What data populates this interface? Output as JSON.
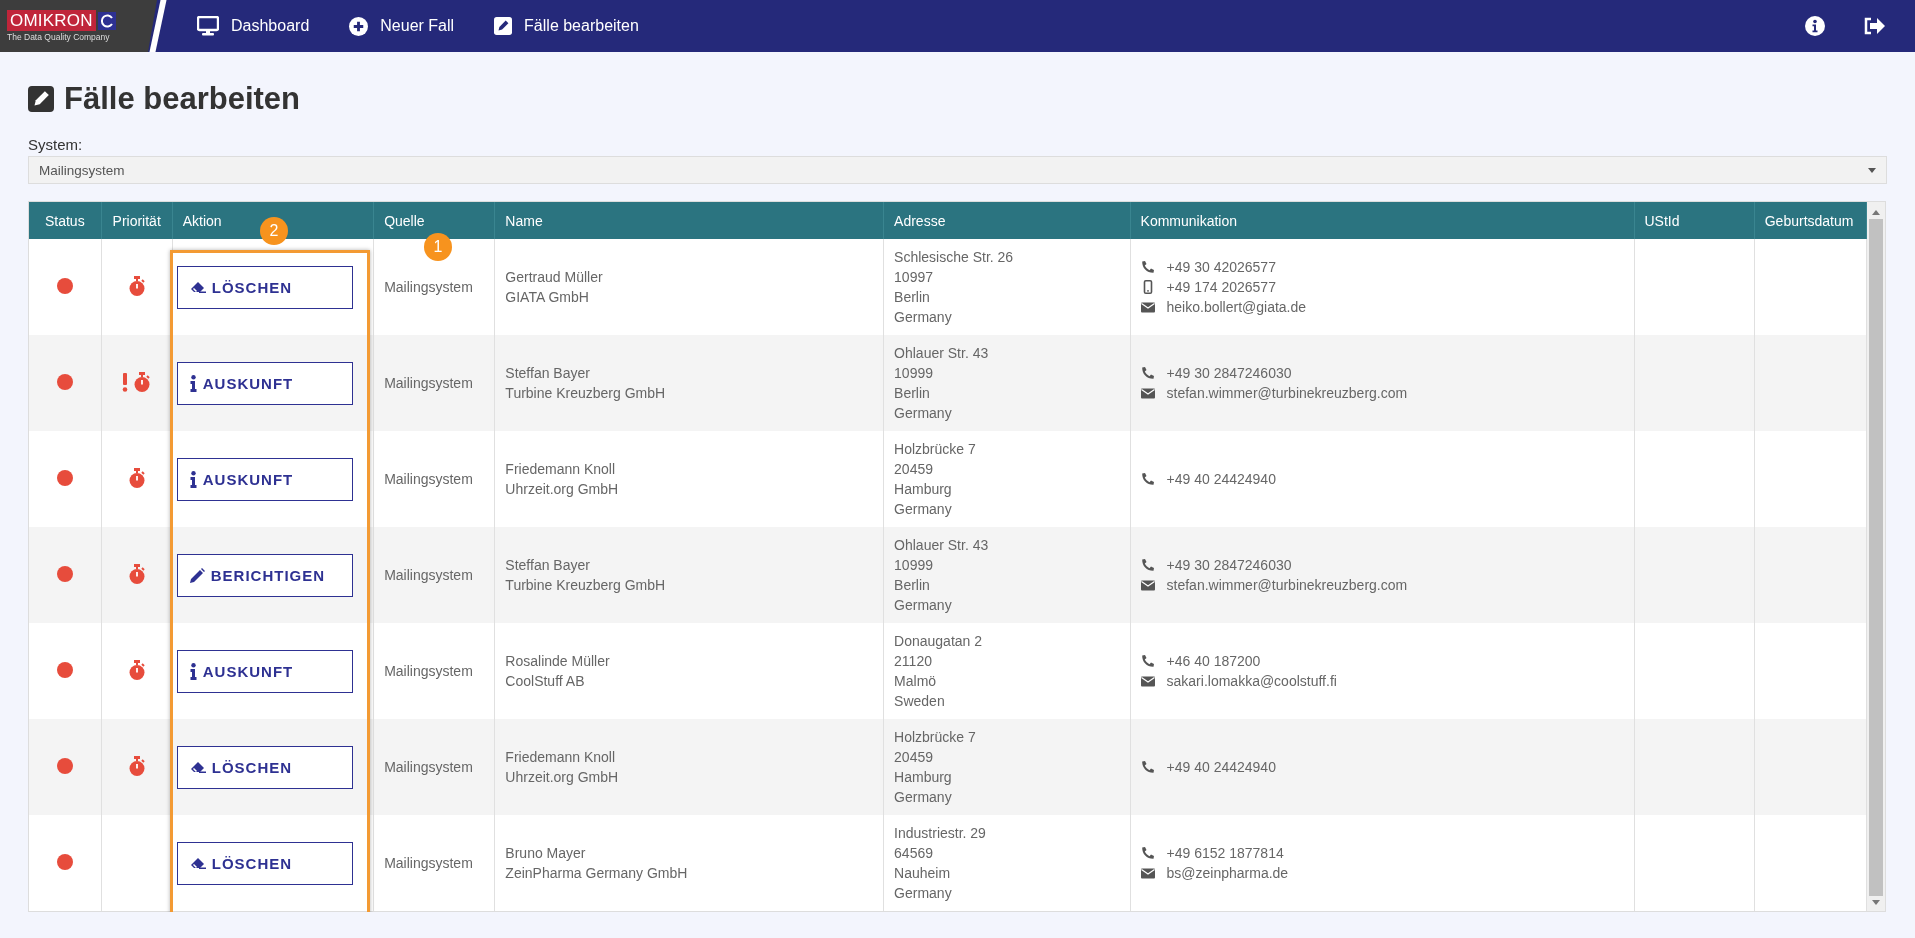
{
  "logo": {
    "name": "OMIKRON",
    "tagline": "The Data Quality Company"
  },
  "nav": [
    {
      "label": "Dashboard"
    },
    {
      "label": "Neuer Fall"
    },
    {
      "label": "Fälle bearbeiten"
    }
  ],
  "page": {
    "title": "Fälle bearbeiten"
  },
  "system": {
    "label": "System:",
    "value": "Mailingsystem"
  },
  "callouts": [
    {
      "label": "2"
    },
    {
      "label": "1"
    }
  ],
  "table": {
    "columns": [
      "Status",
      "Priorität",
      "Aktion",
      "Quelle",
      "Name",
      "Adresse",
      "Kommunikation",
      "UStId",
      "Geburtsdatum"
    ],
    "rows": [
      {
        "color": "#e74c3c",
        "priority": {
          "kind": "timer"
        },
        "action": {
          "kind": "delete",
          "label": "LÖSCHEN"
        },
        "source": "Mailingsystem",
        "name": [
          "Gertraud Müller",
          "GIATA GmbH"
        ],
        "address": [
          "Schlesische Str. 26",
          "10997",
          "Berlin",
          "Germany"
        ],
        "contacts": [
          {
            "kind": "phone",
            "text": "+49 30 42026577"
          },
          {
            "kind": "mobile",
            "text": "+49 174 2026577"
          },
          {
            "kind": "email",
            "text": "heiko.bollert@giata.de"
          }
        ]
      },
      {
        "color": "#e74c3c",
        "priority": {
          "kind": "urgent"
        },
        "action": {
          "kind": "info",
          "label": "AUSKUNFT"
        },
        "source": "Mailingsystem",
        "name": [
          "Steffan Bayer",
          "Turbine Kreuzberg GmbH"
        ],
        "address": [
          "Ohlauer Str. 43",
          "10999",
          "Berlin",
          "Germany"
        ],
        "contacts": [
          {
            "kind": "phone",
            "text": "+49 30 2847246030"
          },
          {
            "kind": "email",
            "text": "stefan.wimmer@turbinekreuzberg.com"
          }
        ]
      },
      {
        "color": "#e74c3c",
        "priority": {
          "kind": "timer"
        },
        "action": {
          "kind": "info",
          "label": "AUSKUNFT"
        },
        "source": "Mailingsystem",
        "name": [
          "Friedemann Knoll",
          "Uhrzeit.org GmbH"
        ],
        "address": [
          "Holzbrücke 7",
          "20459",
          "Hamburg",
          "Germany"
        ],
        "contacts": [
          {
            "kind": "phone",
            "text": "+49 40 24424940"
          }
        ]
      },
      {
        "color": "#e74c3c",
        "priority": {
          "kind": "timer"
        },
        "action": {
          "kind": "correct",
          "label": "BERICHTIGEN"
        },
        "source": "Mailingsystem",
        "name": [
          "Steffan Bayer",
          "Turbine Kreuzberg GmbH"
        ],
        "address": [
          "Ohlauer Str. 43",
          "10999",
          "Berlin",
          "Germany"
        ],
        "contacts": [
          {
            "kind": "phone",
            "text": "+49 30 2847246030"
          },
          {
            "kind": "email",
            "text": "stefan.wimmer@turbinekreuzberg.com"
          }
        ]
      },
      {
        "color": "#e74c3c",
        "priority": {
          "kind": "timer"
        },
        "action": {
          "kind": "info",
          "label": "AUSKUNFT"
        },
        "source": "Mailingsystem",
        "name": [
          "Rosalinde Müller",
          "CoolStuff AB"
        ],
        "address": [
          "Donaugatan 2",
          "21120",
          "Malmö",
          "Sweden"
        ],
        "contacts": [
          {
            "kind": "phone",
            "text": "+46 40 187200"
          },
          {
            "kind": "email",
            "text": "sakari.lomakka@coolstuff.fi"
          }
        ]
      },
      {
        "color": "#e74c3c",
        "priority": {
          "kind": "timer"
        },
        "action": {
          "kind": "delete",
          "label": "LÖSCHEN"
        },
        "source": "Mailingsystem",
        "name": [
          "Friedemann Knoll",
          "Uhrzeit.org GmbH"
        ],
        "address": [
          "Holzbrücke 7",
          "20459",
          "Hamburg",
          "Germany"
        ],
        "contacts": [
          {
            "kind": "phone",
            "text": "+49 40 24424940"
          }
        ]
      },
      {
        "color": "#e74c3c",
        "action": {
          "kind": "delete",
          "label": "LÖSCHEN"
        },
        "source": "Mailingsystem",
        "name": [
          "Bruno Mayer",
          "ZeinPharma Germany GmbH"
        ],
        "address": [
          "Industriestr. 29",
          "64569",
          "Nauheim",
          "Germany"
        ],
        "contacts": [
          {
            "kind": "phone",
            "text": "+49 6152 1877814"
          },
          {
            "kind": "email",
            "text": "bs@zeinpharma.de"
          }
        ]
      }
    ]
  }
}
